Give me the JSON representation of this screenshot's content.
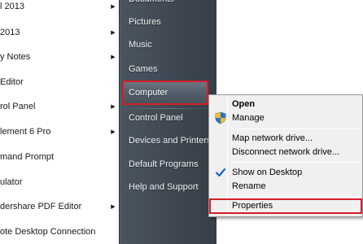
{
  "programs": [
    {
      "label": "l 2013",
      "arrow": true
    },
    {
      "label": "2013",
      "arrow": true
    },
    {
      "label": "y Notes",
      "arrow": true
    },
    {
      "label": "Editor",
      "arrow": false
    },
    {
      "label": "rol Panel",
      "arrow": true
    },
    {
      "label": "lement 6 Pro",
      "arrow": true
    },
    {
      "label": "mand Prompt",
      "arrow": false
    },
    {
      "label": "ulator",
      "arrow": false
    },
    {
      "label": "dershare PDF Editor",
      "arrow": true
    },
    {
      "label": "ote Desktop Connection",
      "arrow": false
    }
  ],
  "right_pane": {
    "items": [
      {
        "label": "Documents"
      },
      {
        "label": "Pictures"
      },
      {
        "label": "Music"
      },
      {
        "label": "Games"
      },
      {
        "label": "Computer"
      },
      {
        "label": "Control Panel"
      },
      {
        "label": "Devices and Printers"
      },
      {
        "label": "Default Programs"
      },
      {
        "label": "Help and Support"
      }
    ]
  },
  "context_menu": {
    "items": [
      {
        "label": "Open",
        "bold": true
      },
      {
        "label": "Manage",
        "icon": "shield-icon"
      },
      {
        "label": "Map network drive..."
      },
      {
        "label": "Disconnect network drive..."
      },
      {
        "label": "Show on Desktop",
        "icon": "checkmark-icon"
      },
      {
        "label": "Rename"
      },
      {
        "label": "Properties"
      }
    ]
  },
  "colors": {
    "highlight_border": "#d71d2a",
    "pane_bg": "#3f4852",
    "menu_bg": "#f0f0f0",
    "shield_blue": "#2f6fd6",
    "shield_yellow": "#f3c221",
    "check_blue": "#1e64c8"
  }
}
